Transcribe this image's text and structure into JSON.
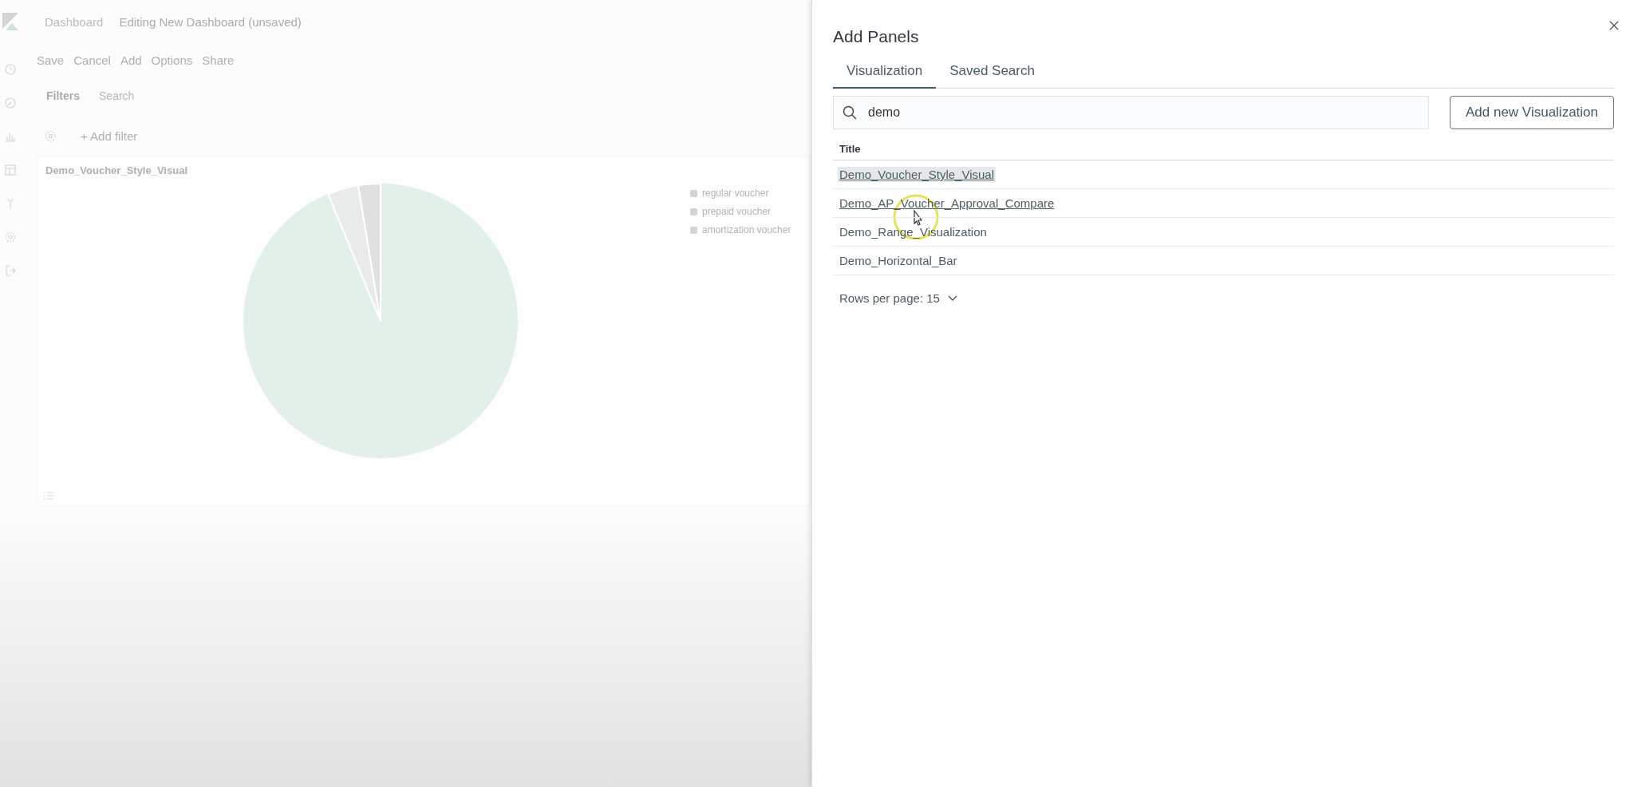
{
  "background": {
    "breadcrumbs": [
      "Dashboard",
      "Editing New Dashboard (unsaved)"
    ],
    "menu": [
      "Save",
      "Cancel",
      "Add",
      "Options",
      "Share"
    ],
    "filters_label": "Filters",
    "search": {
      "placeholder": "Search"
    },
    "add_filter": "+ Add filter",
    "panel": {
      "title": "Demo_Voucher_Style_Visual",
      "legend": [
        "regular voucher",
        "prepaid voucher",
        "amortization voucher"
      ]
    }
  },
  "flyout": {
    "title": "Add Panels",
    "tabs": [
      {
        "label": "Visualization",
        "selected": true
      },
      {
        "label": "Saved Search",
        "selected": false
      }
    ],
    "search": {
      "value": "demo"
    },
    "add_button": "Add new Visualization",
    "table": {
      "columns": [
        "Title"
      ],
      "rows": [
        {
          "title": "Demo_Voucher_Style_Visual",
          "highlighted": true,
          "underlined": true
        },
        {
          "title": "Demo_AP_Voucher_Approval_Compare",
          "highlighted": false,
          "underlined": true
        },
        {
          "title": "Demo_Range_Visualization",
          "highlighted": false,
          "underlined": false
        },
        {
          "title": "Demo_Horizontal_Bar",
          "highlighted": false,
          "underlined": false
        }
      ]
    },
    "rows_per_page": "Rows per page: 15"
  }
}
